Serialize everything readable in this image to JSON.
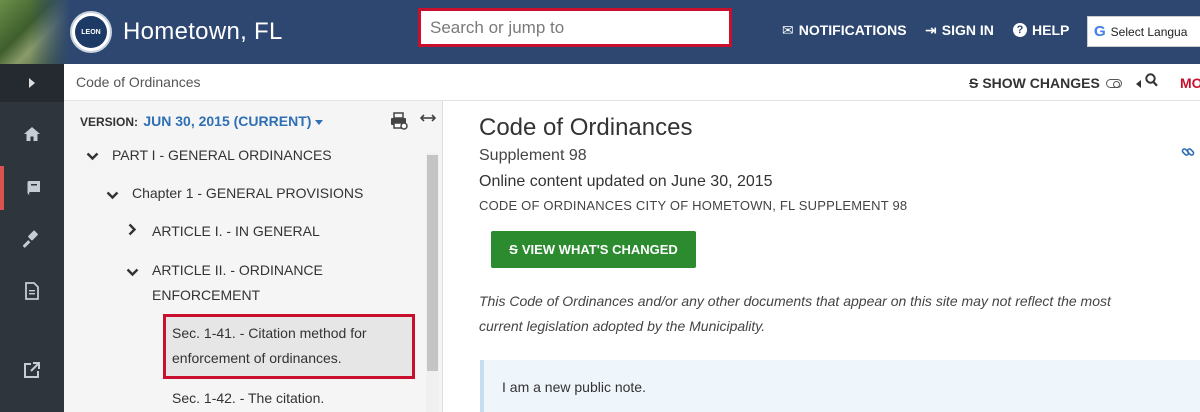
{
  "header": {
    "site_title": "Hometown, FL",
    "seal_text": "LEON",
    "search_placeholder": "Search or jump to",
    "notifications_label": "NOTIFICATIONS",
    "signin_label": "SIGN IN",
    "help_label": "HELP",
    "language_label": "Select Langua",
    "bg_color": "#2e4770",
    "highlight_color": "#c8102e"
  },
  "breadcrumb": {
    "text": "Code of Ordinances",
    "show_changes_label": "SHOW CHANGES",
    "more_label": "MO"
  },
  "toc": {
    "version_label": "VERSION:",
    "version_value": "JUN 30, 2015 (CURRENT)",
    "items": [
      {
        "label": "PART I - GENERAL ORDINANCES",
        "expanded": true
      },
      {
        "label": "Chapter 1 - GENERAL PROVISIONS",
        "expanded": true
      },
      {
        "label": "ARTICLE I. - IN GENERAL",
        "expanded": false
      },
      {
        "label_line1": "ARTICLE II. - ORDINANCE",
        "label_line2": "ENFORCEMENT",
        "expanded": true
      },
      {
        "label_line1": "Sec. 1-41. - Citation method for",
        "label_line2": "enforcement of ordinances.",
        "selected": true
      },
      {
        "label": "Sec. 1-42. - The citation."
      }
    ]
  },
  "main": {
    "title": "Code of Ordinances",
    "supplement": "Supplement 98",
    "updated": "Online content updated on June 30, 2015",
    "caps_line": "CODE OF ORDINANCES CITY OF HOMETOWN, FL SUPPLEMENT 98",
    "view_changed_label": "VIEW WHAT'S CHANGED",
    "disclaimer_line1": "This Code of Ordinances and/or any other documents that appear on this site may not reflect the most",
    "disclaimer_line2": "current legislation adopted by the Municipality.",
    "note": "I am a new public note.",
    "button_color": "#2c8a2f"
  },
  "rail": {
    "icons": [
      "chevron-right-icon",
      "home-icon",
      "book-icon",
      "gavel-icon",
      "document-icon",
      "external-link-icon"
    ]
  }
}
